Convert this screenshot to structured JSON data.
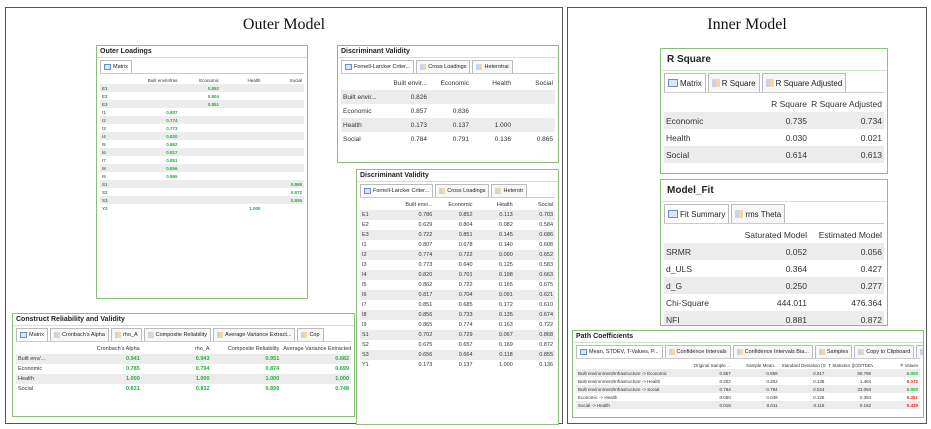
{
  "outer_model_title": "Outer Model",
  "inner_model_title": "Inner Model",
  "outer_loadings": {
    "title": "Outer Loadings",
    "tab": "Matrix",
    "columns": [
      "Built env/Infras",
      "Economic",
      "Health",
      "Social"
    ],
    "rows": [
      {
        "label": "E1",
        "cells": [
          "",
          "0.852",
          "",
          ""
        ]
      },
      {
        "label": "E2",
        "cells": [
          "",
          "0.804",
          "",
          ""
        ]
      },
      {
        "label": "E3",
        "cells": [
          "",
          "0.851",
          "",
          ""
        ]
      },
      {
        "label": "I1",
        "cells": [
          "0.807",
          "",
          "",
          ""
        ]
      },
      {
        "label": "I2",
        "cells": [
          "0.774",
          "",
          "",
          ""
        ]
      },
      {
        "label": "I3",
        "cells": [
          "0.773",
          "",
          "",
          ""
        ]
      },
      {
        "label": "I4",
        "cells": [
          "0.820",
          "",
          "",
          ""
        ]
      },
      {
        "label": "I5",
        "cells": [
          "0.862",
          "",
          "",
          ""
        ]
      },
      {
        "label": "I6",
        "cells": [
          "0.817",
          "",
          "",
          ""
        ]
      },
      {
        "label": "I7",
        "cells": [
          "0.851",
          "",
          "",
          ""
        ]
      },
      {
        "label": "I8",
        "cells": [
          "0.856",
          "",
          "",
          ""
        ]
      },
      {
        "label": "I9",
        "cells": [
          "0.865",
          "",
          "",
          ""
        ]
      },
      {
        "label": "S1",
        "cells": [
          "",
          "",
          "",
          "0.868"
        ]
      },
      {
        "label": "S2",
        "cells": [
          "",
          "",
          "",
          "0.872"
        ]
      },
      {
        "label": "S3",
        "cells": [
          "",
          "",
          "",
          "0.855"
        ]
      },
      {
        "label": "Y2",
        "cells": [
          "",
          "",
          "1.000",
          ""
        ]
      }
    ]
  },
  "dv1": {
    "title": "Discriminant Validity",
    "tabs": [
      "Fornell-Larcker Criter...",
      "Cross Loadings",
      "Heterotrai"
    ],
    "columns": [
      "Built envir...",
      "Economic",
      "Health",
      "Social"
    ],
    "rows": [
      {
        "label": "Built envir...",
        "cells": [
          "0.826",
          "",
          "",
          ""
        ]
      },
      {
        "label": "Economic",
        "cells": [
          "0.857",
          "0.836",
          "",
          ""
        ]
      },
      {
        "label": "Health",
        "cells": [
          "0.173",
          "0.137",
          "1.000",
          ""
        ]
      },
      {
        "label": "Social",
        "cells": [
          "0.784",
          "0.791",
          "0.136",
          "0.865"
        ]
      }
    ]
  },
  "dv2": {
    "title": "Discriminant Validity",
    "tabs": [
      "Fornell-Larcker Criter...",
      "Cross Loadings",
      "Heterotr"
    ],
    "columns": [
      "Built envi...",
      "Economic",
      "Health",
      "Social"
    ],
    "rows": [
      {
        "label": "E1",
        "cells": [
          "0.786",
          "0.852",
          "0.113",
          "0.703"
        ]
      },
      {
        "label": "E2",
        "cells": [
          "0.629",
          "0.804",
          "0.082",
          "0.584"
        ]
      },
      {
        "label": "E3",
        "cells": [
          "0.722",
          "0.851",
          "0.145",
          "0.686"
        ]
      },
      {
        "label": "I1",
        "cells": [
          "0.807",
          "0.678",
          "0.140",
          "0.608"
        ]
      },
      {
        "label": "I2",
        "cells": [
          "0.774",
          "0.722",
          "0.090",
          "0.652"
        ]
      },
      {
        "label": "I3",
        "cells": [
          "0.773",
          "0.640",
          "0.125",
          "0.583"
        ]
      },
      {
        "label": "I4",
        "cells": [
          "0.820",
          "0.701",
          "0.198",
          "0.663"
        ]
      },
      {
        "label": "I5",
        "cells": [
          "0.862",
          "0.722",
          "0.165",
          "0.675"
        ]
      },
      {
        "label": "I6",
        "cells": [
          "0.817",
          "0.704",
          "0.091",
          "0.621"
        ]
      },
      {
        "label": "I7",
        "cells": [
          "0.851",
          "0.685",
          "0.172",
          "0.610"
        ]
      },
      {
        "label": "I8",
        "cells": [
          "0.856",
          "0.733",
          "0.135",
          "0.674"
        ]
      },
      {
        "label": "I9",
        "cells": [
          "0.865",
          "0.774",
          "0.163",
          "0.722"
        ]
      },
      {
        "label": "S1",
        "cells": [
          "0.702",
          "0.729",
          "0.067",
          "0.868"
        ]
      },
      {
        "label": "S2",
        "cells": [
          "0.675",
          "0.657",
          "0.169",
          "0.872"
        ]
      },
      {
        "label": "S3",
        "cells": [
          "0.656",
          "0.664",
          "0.118",
          "0.855"
        ]
      },
      {
        "label": "Y1",
        "cells": [
          "0.173",
          "0.137",
          "1.000",
          "0.136"
        ]
      }
    ]
  },
  "crv": {
    "title": "Construct Reliability and Validity",
    "tabs": [
      "Matrix",
      "Cronbach's Alpha",
      "rho_A",
      "Composite Reliability",
      "Average Variance Extract...",
      "Cop"
    ],
    "columns": [
      "Cronbach's Alpha",
      "rho_A",
      "Composite Reliability",
      "Average Variance Extracted (AVE)"
    ],
    "rows": [
      {
        "label": "Built env/...",
        "cells": [
          "0.941",
          "0.943",
          "0.951",
          "0.682"
        ]
      },
      {
        "label": "Economic",
        "cells": [
          "0.785",
          "0.794",
          "0.874",
          "0.699"
        ]
      },
      {
        "label": "Health",
        "cells": [
          "1.000",
          "1.000",
          "1.000",
          "1.000"
        ]
      },
      {
        "label": "Social",
        "cells": [
          "0.831",
          "0.832",
          "0.899",
          "0.748"
        ]
      }
    ]
  },
  "rsq": {
    "title": "R Square",
    "tabs": [
      "Matrix",
      "R Square",
      "R Square Adjusted"
    ],
    "columns": [
      "R Square",
      "R Square Adjusted"
    ],
    "rows": [
      {
        "label": "Economic",
        "cells": [
          "0.735",
          "0.734"
        ]
      },
      {
        "label": "Health",
        "cells": [
          "0.030",
          "0.021"
        ]
      },
      {
        "label": "Social",
        "cells": [
          "0.614",
          "0.613"
        ]
      }
    ]
  },
  "fit": {
    "title": "Model_Fit",
    "tabs": [
      "Fit Summary",
      "rms Theta"
    ],
    "columns": [
      "Saturated Model",
      "Estimated Model"
    ],
    "rows": [
      {
        "label": "SRMR",
        "cells": [
          "0.052",
          "0.056"
        ]
      },
      {
        "label": "d_ULS",
        "cells": [
          "0.364",
          "0.427"
        ]
      },
      {
        "label": "d_G",
        "cells": [
          "0.250",
          "0.277"
        ]
      },
      {
        "label": "Chi-Square",
        "cells": [
          "444.011",
          "476.364"
        ]
      },
      {
        "label": "NFI",
        "cells": [
          "0.881",
          "0.872"
        ]
      }
    ]
  },
  "pc": {
    "title": "Path Coefficients",
    "tabs": [
      "Mean, STDEV, T-Values, P...",
      "Confidence Intervals",
      "Confidence Intervals Bia...",
      "Samples",
      "Copy to Clipboard",
      "Excel Format",
      "R Form"
    ],
    "columns": [
      "Original Sample ...",
      "Sample Mean...",
      "Standard Deviation (STDEV)",
      "T Statistics (|O/STDEV|)",
      "P Values"
    ],
    "rows": [
      {
        "label": "Built environment/Infrastructure -> Economic",
        "cells": [
          "0.857",
          "0.858",
          "0.017",
          "50.790",
          "0.000"
        ]
      },
      {
        "label": "Built environment/Infrastructure -> Health",
        "cells": [
          "0.202",
          "0.202",
          "0.138",
          "1.464",
          "0.072"
        ]
      },
      {
        "label": "Built environment/Infrastructure -> Social",
        "cells": [
          "0.784",
          "0.784",
          "0.024",
          "33.084",
          "0.000"
        ]
      },
      {
        "label": "Economic -> Health",
        "cells": [
          "0.050",
          "0.049",
          "0.128",
          "0.384",
          "0.351"
        ]
      },
      {
        "label": "Social -> Health",
        "cells": [
          "0.018",
          "0.011",
          "0.116",
          "0.152",
          "0.439"
        ]
      }
    ]
  },
  "colors": {
    "accent_green": "#1faf3a",
    "accent_red": "#e02525",
    "panel_border": "#8cc07a"
  }
}
